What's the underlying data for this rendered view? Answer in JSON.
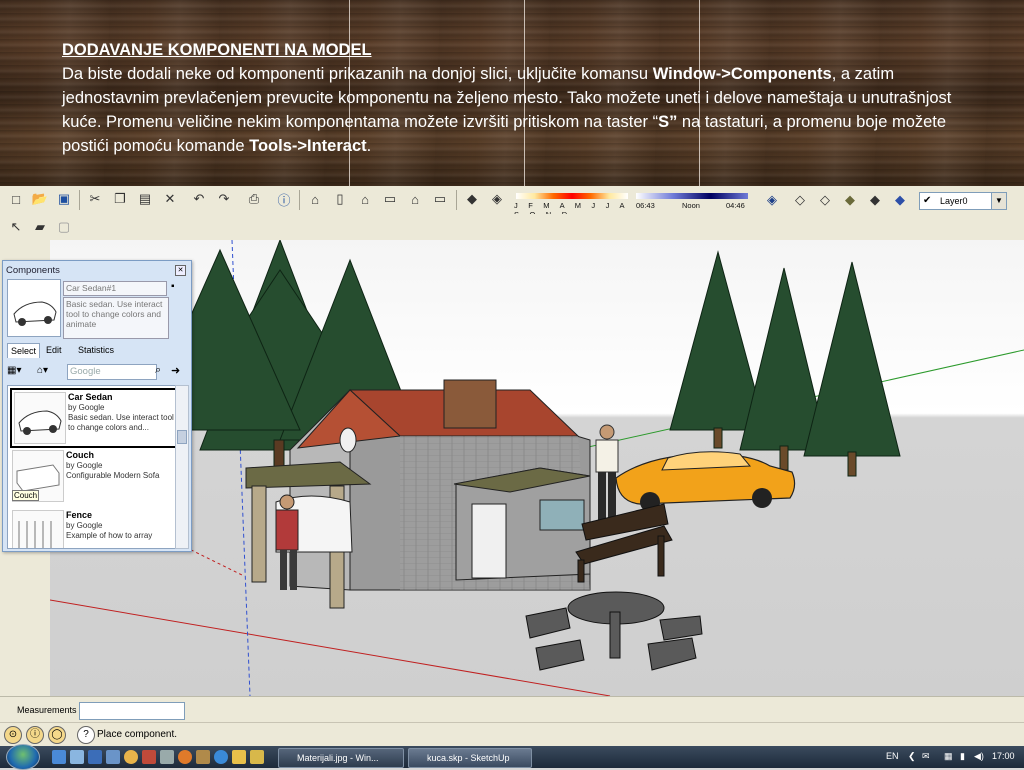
{
  "slide": {
    "title": "DODAVANJE KOMPONENTI NA MODEL",
    "p1": "Da biste dodali neke od komponenti prikazanih na donjoj slici, uključite komansu ",
    "cmd1": "Window->Components",
    "p2": ", a zatim jednostavnim prevlačenjem prevucite komponentu na željeno mesto. Tako možete uneti i delove nameštaja u unutrašnjost kuće. Promenu veličine nekim komponentama možete izvršiti pritiskom na taster “",
    "key": "S”",
    "p3": " na tastaturi, a promenu boje možete postići pomoću komande ",
    "cmd2": "Tools->Interact",
    "p4": "."
  },
  "toolbar": {
    "shadow_months": "J F M A M J J A S O N D",
    "time_start": "06:43",
    "time_noon": "Noon",
    "time_end": "04:46",
    "layer": "Layer0"
  },
  "components": {
    "title": "Components",
    "selected_name": "Car Sedan#1",
    "selected_desc": "Basic sedan.  Use interact tool to change colors and animate",
    "tabs": [
      "Select",
      "Edit",
      "Statistics"
    ],
    "search_placeholder": "Google",
    "items": [
      {
        "name": "Car Sedan",
        "by": "by Google",
        "desc": "Basic sedan.  Use interact tool to change colors and..."
      },
      {
        "name": "Couch",
        "by": "by Google",
        "desc": "Configurable Modern Sofa",
        "tooltip": "Couch"
      },
      {
        "name": "Fence",
        "by": "by Google",
        "desc": "Example of how to array"
      }
    ]
  },
  "status": {
    "measurements_label": "Measurements",
    "message": "Place component."
  },
  "taskbar": {
    "tasks": [
      "Materijali.jpg - Win...",
      "kuca.skp - SketchUp"
    ],
    "lang": "EN",
    "clock": "17:00"
  }
}
